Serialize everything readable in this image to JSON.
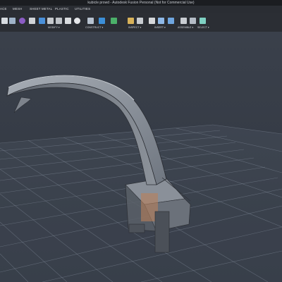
{
  "window": {
    "title": "kubicle prowd - Autodesk Fusion Personal (Not for Commercial Use)"
  },
  "document": {
    "tab_label": "kubicle prowd"
  },
  "toolbar": {
    "tabs": [
      "ACE",
      "MESH",
      "SHEET METAL",
      "PLASTIC",
      "UTILITIES"
    ],
    "groups": [
      {
        "label": "MODIFY ▾"
      },
      {
        "label": "CONSTRUCT ▾"
      },
      {
        "label": "INSPECT ▾"
      },
      {
        "label": "INSERT ▾"
      },
      {
        "label": "ASSEMBLE ▾"
      },
      {
        "label": "SELECT ▾"
      }
    ]
  },
  "icons": [
    "cube-icon",
    "move-icon",
    "fillet-icon",
    "shell-icon",
    "scale-icon",
    "combine-icon",
    "plane-icon",
    "axis-icon",
    "measure-icon",
    "insert-icon",
    "joint-icon",
    "cursor-icon"
  ],
  "colors": {
    "accent": "#4a90d9",
    "model_surface": "#8f96a0",
    "highlight": "#d8a27a"
  }
}
